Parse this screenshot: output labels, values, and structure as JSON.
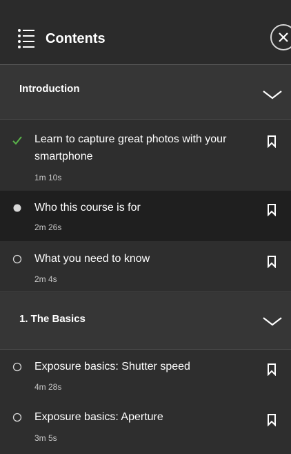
{
  "header": {
    "title": "Contents",
    "toc_icon": "table-of-contents-icon",
    "close_icon": "close-icon"
  },
  "sections": [
    {
      "title": "Introduction",
      "chevron_icon": "chevron-down-icon",
      "items": [
        {
          "label": "Learn to capture great photos with your smartphone",
          "duration": "1m 10s",
          "status": "completed",
          "status_icon": "checkmark-icon",
          "bookmark_icon": "bookmark-icon"
        },
        {
          "label": "Who this course is for",
          "duration": "2m 26s",
          "status": "current",
          "status_icon": "filled-circle-icon",
          "bookmark_icon": "bookmark-icon"
        },
        {
          "label": "What you need to know",
          "duration": "2m 4s",
          "status": "not-started",
          "status_icon": "empty-circle-icon",
          "bookmark_icon": "bookmark-icon"
        }
      ]
    },
    {
      "title": "1. The Basics",
      "chevron_icon": "chevron-down-icon",
      "items": [
        {
          "label": "Exposure basics: Shutter speed",
          "duration": "4m 28s",
          "status": "not-started",
          "status_icon": "empty-circle-icon",
          "bookmark_icon": "bookmark-icon"
        },
        {
          "label": "Exposure basics: Aperture",
          "duration": "3m 5s",
          "status": "not-started",
          "status_icon": "empty-circle-icon",
          "bookmark_icon": "bookmark-icon"
        }
      ]
    }
  ],
  "colors": {
    "background": "#2e2e2e",
    "section_background": "#363636",
    "active_row": "#1f1f1f",
    "completed_check": "#5ab54a",
    "divider": "#575757"
  }
}
